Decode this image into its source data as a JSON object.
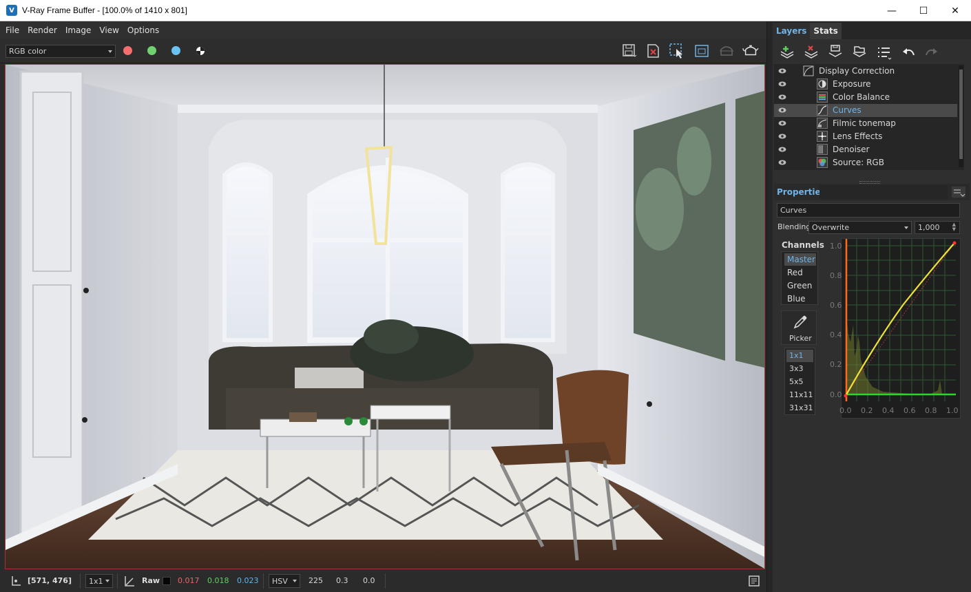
{
  "window": {
    "title": "V-Ray Frame Buffer - [100.0% of 1410 x 801]",
    "minimize": "—",
    "maximize": "☐",
    "close": "✕",
    "logo": "V"
  },
  "menu": [
    "File",
    "Render",
    "Image",
    "View",
    "Options"
  ],
  "toolbar": {
    "channel_select": "RGB color",
    "icons": [
      "save-image-icon",
      "clear-image-icon",
      "region-render-icon",
      "region-icon",
      "render-last-icon",
      "teapot-render-icon"
    ]
  },
  "colors": {
    "red": "#f56f6f",
    "green": "#6fd16f",
    "blue": "#69c3f2",
    "accent": "#6fb4e8",
    "frame": "#a23535"
  },
  "statusbar": {
    "coords": "[571, 476]",
    "sample_size": "1x1",
    "mode": "Raw",
    "r": "0.017",
    "g": "0.018",
    "b": "0.023",
    "color_space": "HSV",
    "h": "225",
    "s": "0.3",
    "v": "0.0"
  },
  "right_panel": {
    "tabs": [
      "Layers",
      "Stats"
    ],
    "layers": [
      {
        "name": "Display Correction",
        "icon": "display-correction-icon",
        "indent": 0
      },
      {
        "name": "Exposure",
        "icon": "exposure-icon",
        "indent": 1
      },
      {
        "name": "Color Balance",
        "icon": "color-balance-icon",
        "indent": 1
      },
      {
        "name": "Curves",
        "icon": "curves-icon",
        "indent": 1,
        "selected": true
      },
      {
        "name": "Filmic tonemap",
        "icon": "filmic-tonemap-icon",
        "indent": 1
      },
      {
        "name": "Lens Effects",
        "icon": "lens-effects-icon",
        "indent": 1
      },
      {
        "name": "Denoiser",
        "icon": "denoiser-icon",
        "indent": 1
      },
      {
        "name": "Source: RGB",
        "icon": "source-rgb-icon",
        "indent": 1
      }
    ],
    "properties": {
      "title": "Properties",
      "layer_name": "Curves",
      "blending_label": "Blending",
      "blending_mode": "Overwrite",
      "blending_amount": "1,000",
      "channels_label": "Channels",
      "channels": [
        "Master",
        "Red",
        "Green",
        "Blue"
      ],
      "picker_label": "Picker",
      "sample_sizes": [
        "1x1",
        "3x3",
        "5x5",
        "11x11",
        "31x31"
      ],
      "curve_ticks_y": [
        "1.0",
        "0.8",
        "0.6",
        "0.4",
        "0.2",
        "0.0"
      ],
      "curve_ticks_x": [
        "0.0",
        "0.2",
        "0.4",
        "0.6",
        "0.8",
        "1.0"
      ]
    }
  }
}
